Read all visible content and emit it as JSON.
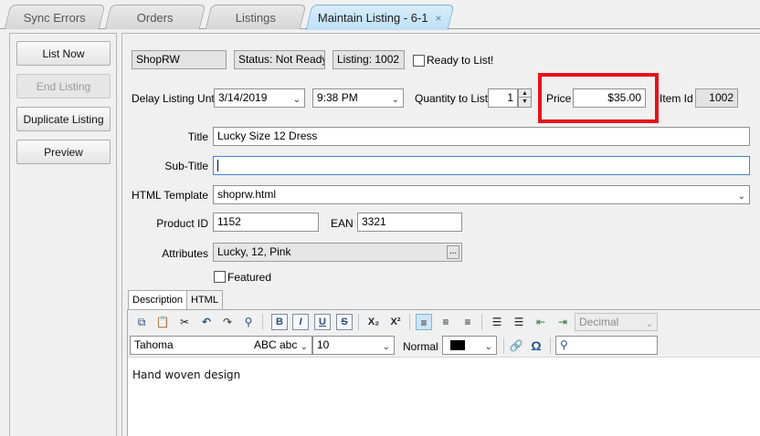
{
  "tabs": [
    {
      "label": "Sync Errors"
    },
    {
      "label": "Orders"
    },
    {
      "label": "Listings"
    },
    {
      "label": "Maintain Listing - 6-1",
      "close": "×"
    }
  ],
  "actions": {
    "list_now": "List Now",
    "end_listing": "End Listing",
    "duplicate_listing": "Duplicate Listing",
    "preview": "Preview"
  },
  "header": {
    "store": "ShopRW",
    "status": "Status: Not Ready",
    "listing": "Listing: 1002",
    "ready_label": "Ready to List!"
  },
  "delay": {
    "label": "Delay Listing Until",
    "date": "3/14/2019",
    "time": "9:38 PM"
  },
  "quantity": {
    "label": "Quantity to List",
    "value": "1"
  },
  "price": {
    "label": "Price",
    "value": "$35.00"
  },
  "item_id": {
    "label": "Item Id",
    "value": "1002"
  },
  "title": {
    "label": "Title",
    "value": "Lucky Size 12 Dress"
  },
  "subtitle": {
    "label": "Sub-Title",
    "value": ""
  },
  "html_template": {
    "label": "HTML Template",
    "value": "shoprw.html"
  },
  "product_id": {
    "label": "Product ID",
    "value": "1152"
  },
  "ean": {
    "label": "EAN",
    "value": "3321"
  },
  "attributes": {
    "label": "Attributes",
    "value": "Lucky, 12, Pink",
    "button": "..."
  },
  "featured": {
    "label": "Featured"
  },
  "editor": {
    "tabs": [
      "Description",
      "HTML"
    ],
    "format_select": "Decimal",
    "font": "Tahoma",
    "font_preview": "ABC abc",
    "size": "10",
    "style": "Normal",
    "content": "Hand woven design"
  },
  "colors": {
    "highlight": "#e3141b",
    "active_tab": "#bfe0f6"
  }
}
